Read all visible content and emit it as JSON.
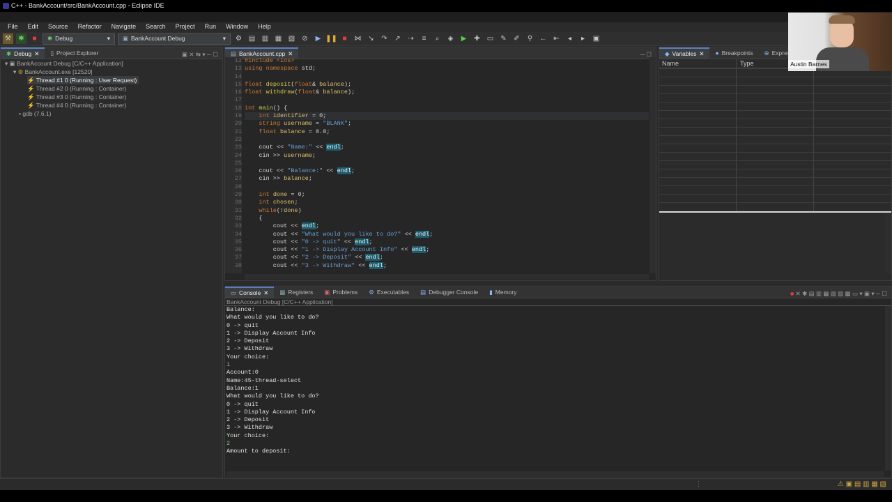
{
  "window": {
    "title": "C++ - BankAccount/src/BankAccount.cpp - Eclipse IDE"
  },
  "menu": [
    "File",
    "Edit",
    "Source",
    "Refactor",
    "Navigate",
    "Search",
    "Project",
    "Run",
    "Window",
    "Help"
  ],
  "toolbar": {
    "mode_label": "Debug",
    "launch_config": "BankAccount Debug"
  },
  "debug_view": {
    "tabs": [
      "Debug",
      "Project Explorer"
    ],
    "tree": [
      "BankAccount Debug [C/C++ Application]",
      "BankAccount.exe [12520]",
      "Thread #1 0 (Running : User Request)",
      "Thread #2 0 (Running : Container)",
      "Thread #3 0 (Running : Container)",
      "Thread #4 0 (Running : Container)",
      "gdb (7.6.1)"
    ]
  },
  "editor": {
    "tab": "BankAccount.cpp",
    "lines": [
      {
        "n": "12",
        "t": "#include <ios>"
      },
      {
        "n": "13",
        "t": "using namespace std;"
      },
      {
        "n": "14",
        "t": ""
      },
      {
        "n": "15",
        "t": "float deposit(float& balance);"
      },
      {
        "n": "16",
        "t": "float withdraw(float& balance);"
      },
      {
        "n": "17",
        "t": ""
      },
      {
        "n": "18",
        "t": "int main() {"
      },
      {
        "n": "19",
        "t": "    int identifier = 0;"
      },
      {
        "n": "20",
        "t": "    string username = \"BLANK\";"
      },
      {
        "n": "21",
        "t": "    float balance = 0.0;"
      },
      {
        "n": "22",
        "t": ""
      },
      {
        "n": "23",
        "t": "    cout << \"Name:\" << endl;"
      },
      {
        "n": "24",
        "t": "    cin >> username;"
      },
      {
        "n": "25",
        "t": ""
      },
      {
        "n": "26",
        "t": "    cout << \"Balance:\" << endl;"
      },
      {
        "n": "27",
        "t": "    cin >> balance;"
      },
      {
        "n": "28",
        "t": ""
      },
      {
        "n": "29",
        "t": "    int done = 0;"
      },
      {
        "n": "30",
        "t": "    int chosen;"
      },
      {
        "n": "31",
        "t": "    while(!done)"
      },
      {
        "n": "32",
        "t": "    {"
      },
      {
        "n": "33",
        "t": "        cout << endl;"
      },
      {
        "n": "34",
        "t": "        cout << \"What would you like to do?\" << endl;"
      },
      {
        "n": "35",
        "t": "        cout << \"0 -> quit\" << endl;"
      },
      {
        "n": "36",
        "t": "        cout << \"1 -> Display Account Info\" << endl;"
      },
      {
        "n": "37",
        "t": "        cout << \"2 -> Deposit\" << endl;"
      },
      {
        "n": "38",
        "t": "        cout << \"3 -> Withdraw\" << endl;"
      }
    ]
  },
  "variables_view": {
    "tabs": [
      "Variables",
      "Breakpoints",
      "Expressions"
    ],
    "columns": [
      "Name",
      "Type"
    ]
  },
  "console": {
    "tabs": [
      "Console",
      "Registers",
      "Problems",
      "Executables",
      "Debugger Console",
      "Memory"
    ],
    "header": "BankAccount Debug [C/C++ Application]",
    "lines": [
      {
        "t": "Balance:",
        "input": false
      },
      {
        "t": "What would you like to do?",
        "input": false
      },
      {
        "t": "0 -> quit",
        "input": false
      },
      {
        "t": "1 -> Display Account Info",
        "input": false
      },
      {
        "t": "2 -> Deposit",
        "input": false
      },
      {
        "t": "3 -> Withdraw",
        "input": false
      },
      {
        "t": "Your choice:",
        "input": false
      },
      {
        "t": "1",
        "input": true
      },
      {
        "t": "Account:0",
        "input": false
      },
      {
        "t": "Name:45-thread-select",
        "input": false
      },
      {
        "t": "Balance:1",
        "input": false
      },
      {
        "t": "What would you like to do?",
        "input": false
      },
      {
        "t": "0 -> quit",
        "input": false
      },
      {
        "t": "1 -> Display Account Info",
        "input": false
      },
      {
        "t": "2 -> Deposit",
        "input": false
      },
      {
        "t": "3 -> Withdraw",
        "input": false
      },
      {
        "t": "Your choice:",
        "input": false
      },
      {
        "t": "2",
        "input": true
      },
      {
        "t": "Amount to deposit:",
        "input": false
      }
    ]
  },
  "webcam": {
    "name": "Austin Barnes"
  }
}
